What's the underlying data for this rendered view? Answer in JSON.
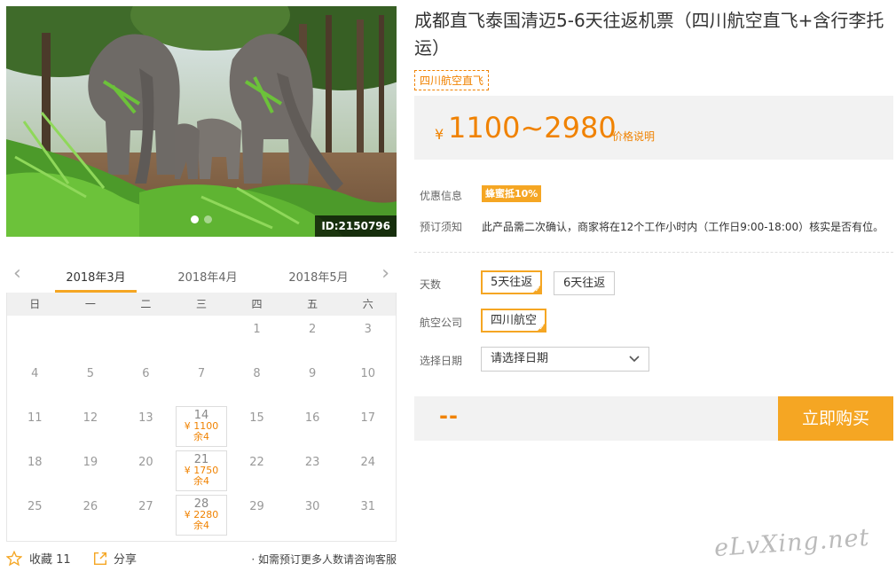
{
  "product": {
    "title": "成都直飞泰国清迈5-6天往返机票（四川航空直飞+含行李托运）",
    "tag": "四川航空直飞",
    "image_id": "ID:2150796"
  },
  "carousel": {
    "dots": 2,
    "active": 0
  },
  "price": {
    "currency": "¥",
    "range": "1100~2980",
    "explain_link": "价格说明"
  },
  "info": {
    "discount_label": "优惠信息",
    "discount_badge": "蜂蜜抵10%",
    "notice_label": "预订须知",
    "notice_text": "此产品需二次确认，商家将在12个工作小时内（工作日9:00-18:00）核实是否有位。"
  },
  "options": {
    "days_label": "天数",
    "days": [
      {
        "label": "5天往返",
        "selected": true
      },
      {
        "label": "6天往返",
        "selected": false
      }
    ],
    "airline_label": "航空公司",
    "airlines": [
      {
        "label": "四川航空",
        "selected": true
      }
    ],
    "date_label": "选择日期",
    "date_placeholder": "请选择日期"
  },
  "buy": {
    "total": "--",
    "button": "立即购买"
  },
  "calendar": {
    "months": [
      "2018年3月",
      "2018年4月",
      "2018年5月"
    ],
    "active_month": 0,
    "weekdays": [
      "日",
      "一",
      "二",
      "三",
      "四",
      "五",
      "六"
    ],
    "lead_blanks": 4,
    "days_in_month": 31,
    "priced_days": {
      "14": {
        "price": "¥ 1100",
        "left": "余4"
      },
      "21": {
        "price": "¥ 1750",
        "left": "余4"
      },
      "28": {
        "price": "¥ 2280",
        "left": "余4"
      }
    }
  },
  "bottom": {
    "fav_label": "收藏 11",
    "share_label": "分享",
    "hint": "· 如需预订更多人数请咨询客服"
  },
  "watermark": "eLvXing.net",
  "colors": {
    "accent": "#f5a623",
    "price": "#f08200"
  }
}
